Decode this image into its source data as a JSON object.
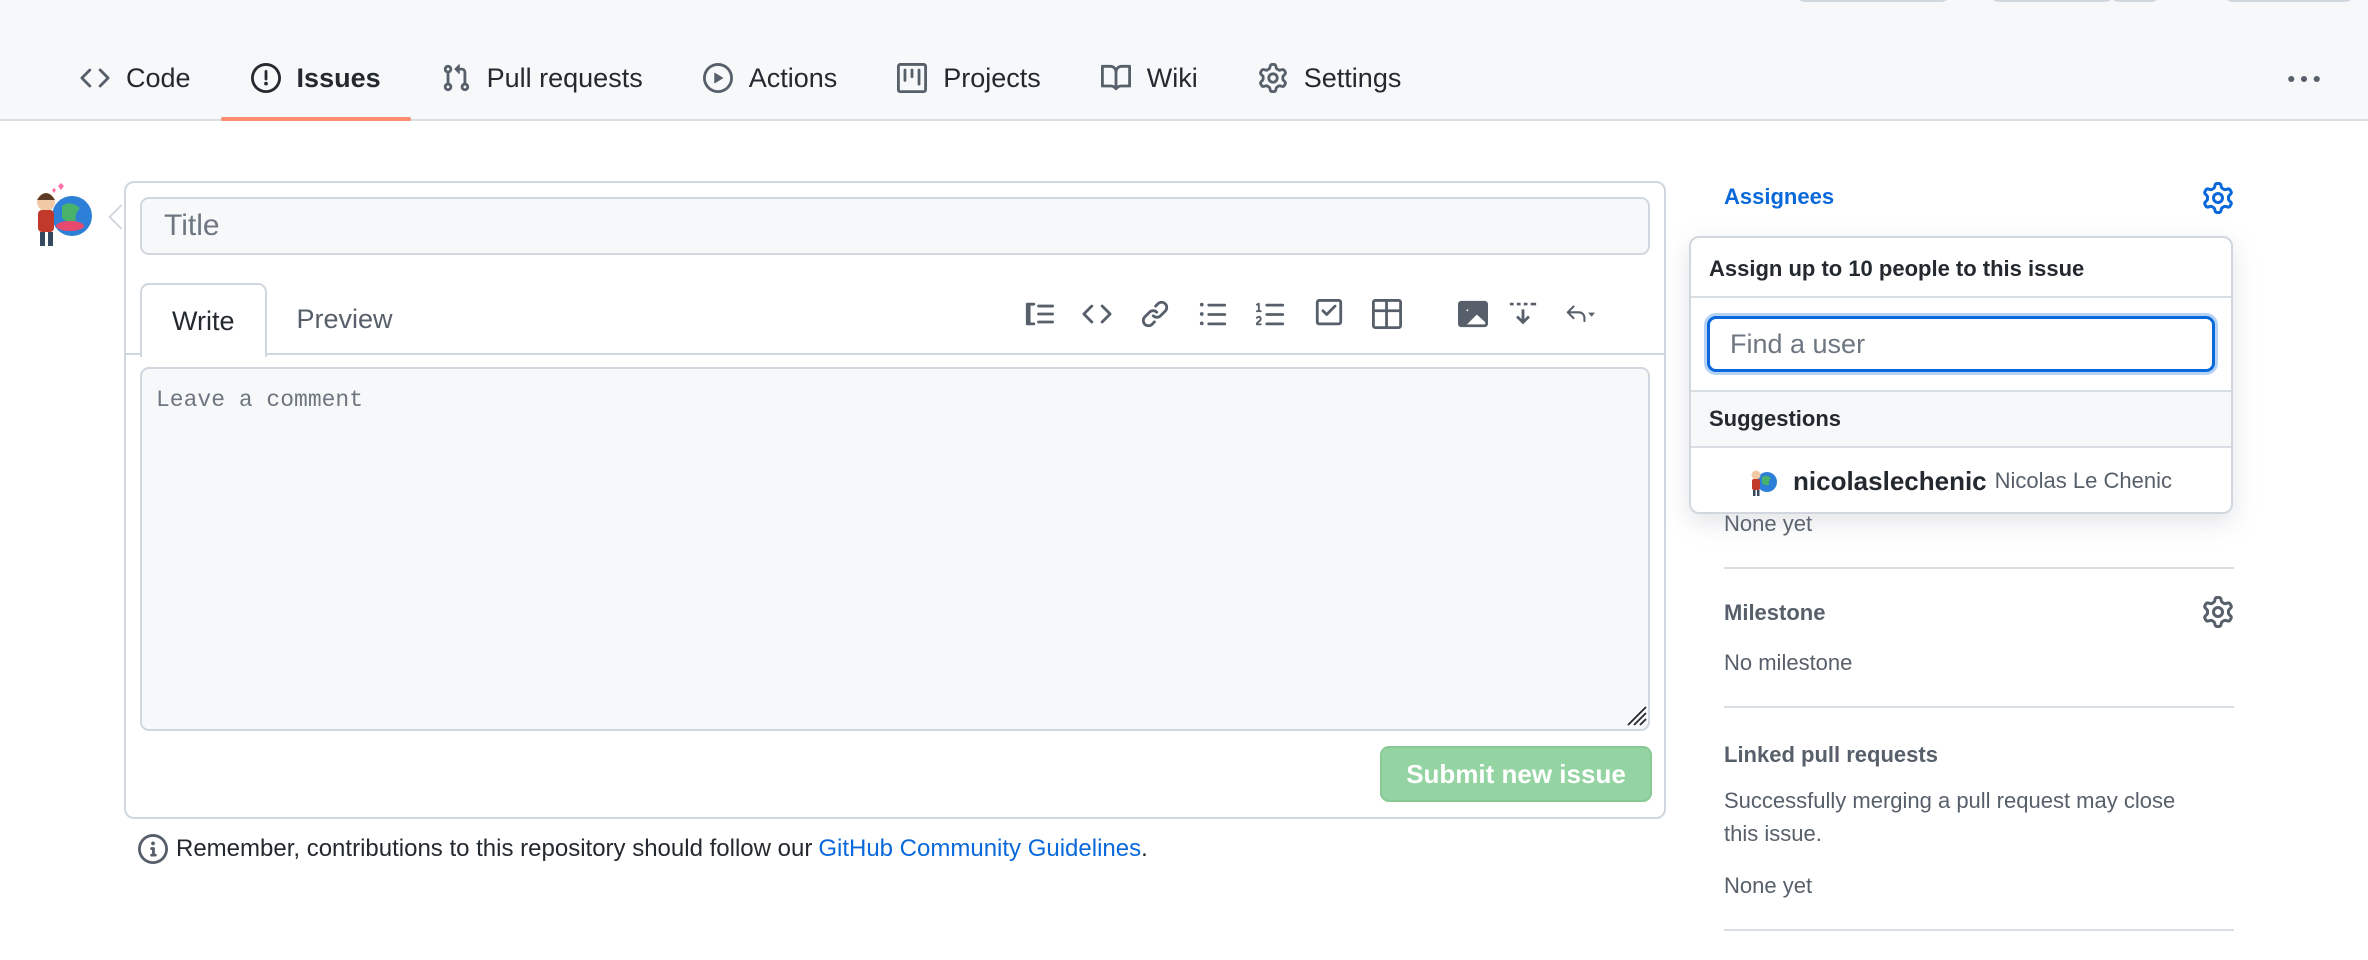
{
  "nav": {
    "tabs": [
      {
        "label": "Code",
        "icon": "code-icon",
        "active": false
      },
      {
        "label": "Issues",
        "icon": "issue-icon",
        "active": true
      },
      {
        "label": "Pull requests",
        "icon": "pull-request-icon",
        "active": false
      },
      {
        "label": "Actions",
        "icon": "play-icon",
        "active": false
      },
      {
        "label": "Projects",
        "icon": "project-icon",
        "active": false
      },
      {
        "label": "Wiki",
        "icon": "book-icon",
        "active": false
      },
      {
        "label": "Settings",
        "icon": "gear-icon",
        "active": false
      }
    ],
    "underline_color": "#fd8c73"
  },
  "composer": {
    "title_placeholder": "Title",
    "tabs": {
      "write": "Write",
      "preview": "Preview"
    },
    "comment_placeholder": "Leave a comment",
    "submit_label": "Submit new issue",
    "submit_color": "#94d3a2",
    "toolbar_icons": [
      "heading-icon",
      "code-icon",
      "link-icon",
      "unordered-list-icon",
      "ordered-list-icon",
      "task-list-icon",
      "table-icon",
      "image-icon",
      "collapse-icon",
      "reply-icon"
    ]
  },
  "guideline": {
    "text": "Remember, contributions to this repository should follow our",
    "link": "GitHub Community Guidelines",
    "end": "."
  },
  "sidebar": {
    "assignees_heading": "Assignees",
    "labels_value": "None yet",
    "milestone_heading": "Milestone",
    "milestone_value": "No milestone",
    "linked_heading": "Linked pull requests",
    "linked_desc_1": "Successfully merging a pull request may close",
    "linked_desc_2": "this issue.",
    "linked_value": "None yet",
    "accent_color": "#0969da"
  },
  "assignee_dropdown": {
    "header": "Assign up to 10 people to this issue",
    "search_placeholder": "Find a user",
    "suggestions_label": "Suggestions",
    "suggestions": [
      {
        "login": "nicolaslechenic",
        "name": "Nicolas Le Chenic"
      }
    ]
  }
}
